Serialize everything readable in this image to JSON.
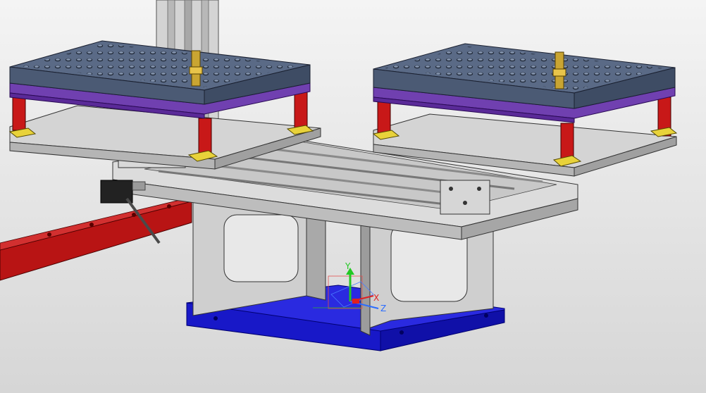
{
  "viewport": {
    "background_top": "#f4f4f4",
    "background_bottom": "#d8d8d8"
  },
  "triad": {
    "y_label": "Y",
    "x_label": "X",
    "z_label": "Z",
    "y_color": "#22c822",
    "x_color": "#e02020",
    "z_color": "#2a6cff"
  },
  "colors": {
    "rail": "#b81414",
    "base_plate": "#1818c8",
    "fixture_plate": "#5a6a86",
    "spacer_plate": "#7040b0",
    "standoff": "#d02020",
    "foot": "#e8d23a",
    "frame": "#cfcfcf"
  }
}
